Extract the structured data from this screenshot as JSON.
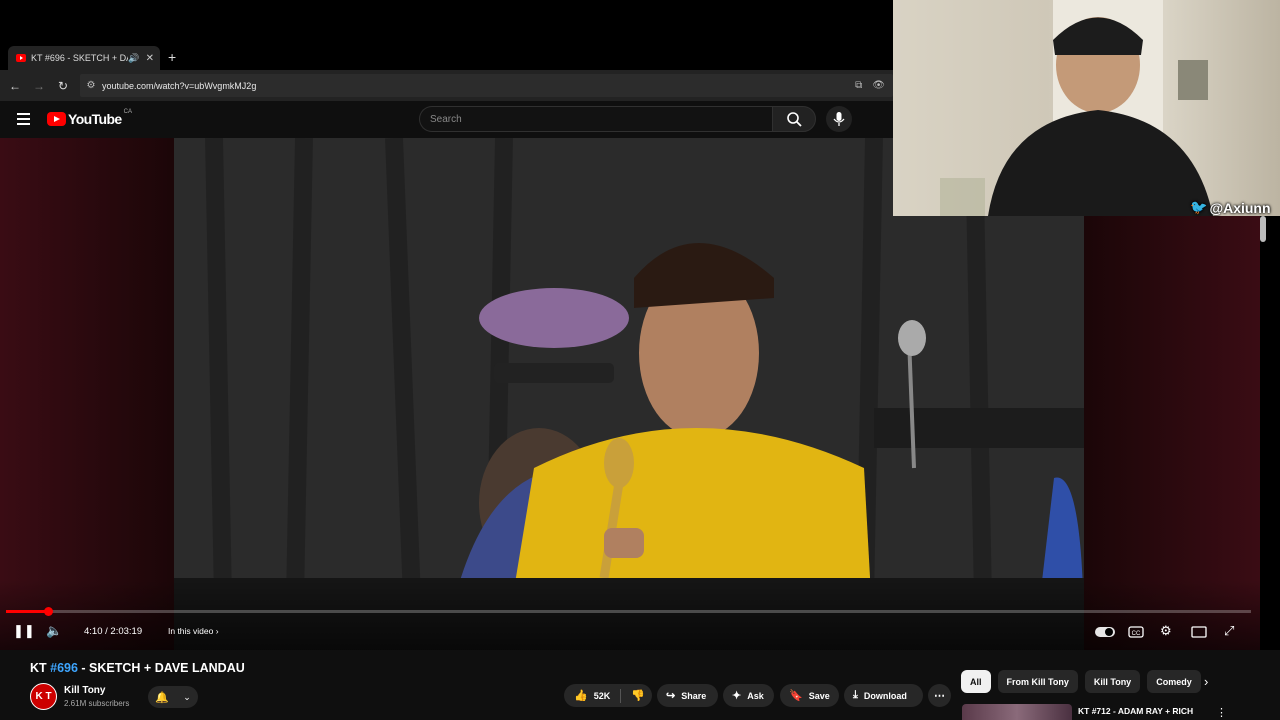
{
  "browser": {
    "tab_title": "KT #696 - SKETCH + DAVE LANDAU",
    "new_tab_label": "+",
    "url": "youtube.com/watch?v=ubWvgmkMJ2g"
  },
  "youtube": {
    "logo_text": "YouTube",
    "country_code": "CA",
    "search_placeholder": "Search"
  },
  "player": {
    "current_time": "4:10",
    "duration": "2:03:19",
    "time_display": "4:10 / 2:03:19",
    "progress_fraction": 0.0338,
    "in_this_video_label": "In this video"
  },
  "video": {
    "title_prefix": "KT ",
    "title_hash": "#696",
    "title_suffix": " - SKETCH + DAVE LANDAU"
  },
  "channel": {
    "avatar_text": "K T",
    "name": "Kill Tony",
    "subscribers": "2.61M subscribers"
  },
  "actions": {
    "like_count": "52K",
    "share_label": "Share",
    "ask_label": "Ask",
    "save_label": "Save",
    "download_label": "Download"
  },
  "chips": [
    "All",
    "From Kill Tony",
    "Kill Tony",
    "Comedy"
  ],
  "recommendation": {
    "title": "KT #712 - ADAM RAY + RICH"
  },
  "overlay": {
    "twitter_handle": "@Axiunn"
  },
  "colors": {
    "youtube_red": "#ff0000",
    "link_blue": "#3ea6ff",
    "background": "#0f0f0f",
    "twitter_blue": "#1d9bf0"
  }
}
